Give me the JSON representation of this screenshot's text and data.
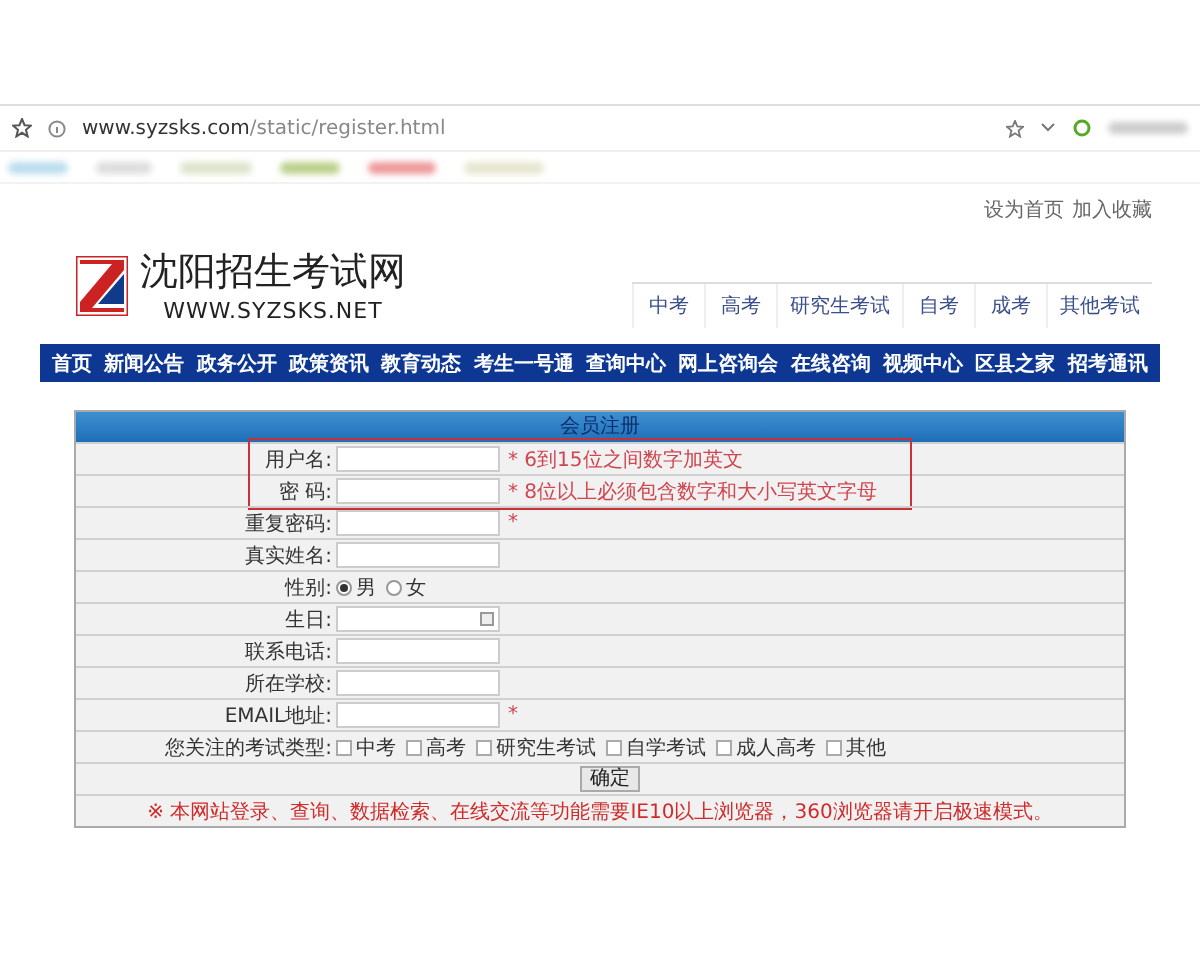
{
  "browser": {
    "url_domain": "www.syzsks.com",
    "url_path": "/static/register.html"
  },
  "top_links": [
    "设为首页",
    "加入收藏"
  ],
  "logo": {
    "title": "沈阳招生考试网",
    "subtitle": "WWW.SYZSKS.NET"
  },
  "exam_tabs": [
    "中考",
    "高考",
    "研究生考试",
    "自考",
    "成考",
    "其他考试"
  ],
  "nav": [
    "首页",
    "新闻公告",
    "政务公开",
    "政策资讯",
    "教育动态",
    "考生一号通",
    "查询中心",
    "网上咨询会",
    "在线咨询",
    "视频中心",
    "区县之家",
    "招考通讯"
  ],
  "form": {
    "title": "会员注册",
    "fields": [
      {
        "kind": "text",
        "label": "用户名:",
        "hint": "* 6到15位之间数字加英文",
        "highlighted": true
      },
      {
        "kind": "text",
        "label": "密 码:",
        "hint": "* 8位以上必须包含数字和大小写英文字母",
        "highlighted": true
      },
      {
        "kind": "text",
        "label": "重复密码:",
        "hint": "*",
        "highlighted": false
      },
      {
        "kind": "text",
        "label": "真实姓名:",
        "highlighted": false
      },
      {
        "kind": "radio",
        "label": "性别:",
        "options": [
          {
            "label": "男",
            "selected": true
          },
          {
            "label": "女",
            "selected": false
          }
        ],
        "highlighted": false
      },
      {
        "kind": "date",
        "label": "生日:",
        "highlighted": false
      },
      {
        "kind": "text",
        "label": "联系电话:",
        "highlighted": false
      },
      {
        "kind": "text",
        "label": "所在学校:",
        "highlighted": false
      },
      {
        "kind": "text",
        "label": "EMAIL地址:",
        "hint": "*",
        "highlighted": false
      },
      {
        "kind": "checkboxes",
        "label": "您关注的考试类型:",
        "options": [
          {
            "label": "中考",
            "checked": false
          },
          {
            "label": "高考",
            "checked": false
          },
          {
            "label": "研究生考试",
            "checked": false
          },
          {
            "label": "自学考试",
            "checked": false
          },
          {
            "label": "成人高考",
            "checked": false
          },
          {
            "label": "其他",
            "checked": false
          }
        ],
        "highlighted": false
      }
    ],
    "submit": "确定",
    "notice": "※ 本网站登录、查询、数据检索、在线交流等功能需要IE10以上浏览器，360浏览器请开启极速模式。"
  }
}
